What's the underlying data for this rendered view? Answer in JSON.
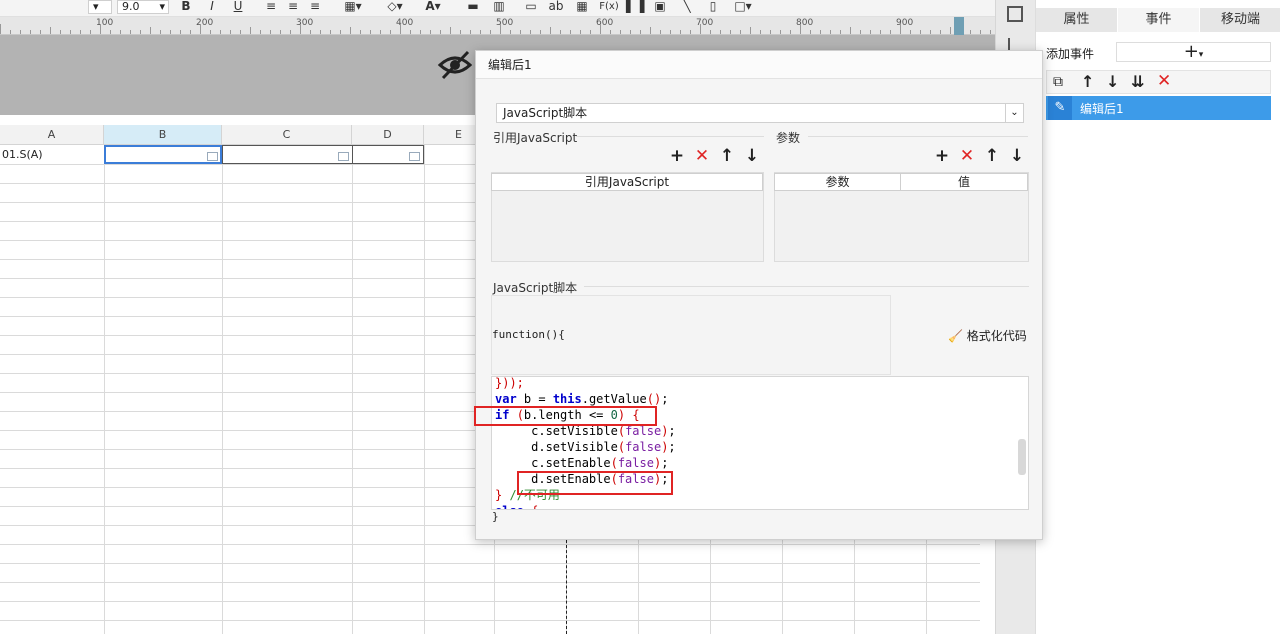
{
  "toolbar": {
    "font_size": "9.0",
    "bold": "B",
    "italic": "I",
    "underline": "U",
    "text_label": "ab",
    "formula_label": "F(x)"
  },
  "ruler": {
    "marks": [
      "100",
      "200",
      "300",
      "400",
      "500",
      "600",
      "700",
      "800",
      "900"
    ]
  },
  "sheet": {
    "columns": [
      "A",
      "B",
      "C",
      "D",
      "E"
    ],
    "cell_a1": "01.S(A)"
  },
  "right_panel": {
    "tabs": [
      "属性",
      "事件",
      "移动端"
    ],
    "add_event_label": "添加事件",
    "add_button": "+",
    "event_item": "编辑后1"
  },
  "dialog": {
    "title": "编辑后1",
    "script_type": "JavaScript脚本",
    "ref_js_label": "引用JavaScript",
    "params_label": "参数",
    "ref_js_header": "引用JavaScript",
    "param_header": "参数",
    "value_header": "值",
    "script_label": "JavaScript脚本",
    "function_header": "function(){",
    "format_button": "格式化代码",
    "code_lines": [
      "}));",
      "var b = this.getValue();",
      "if (b.length <= 0) {",
      "    c.setVisible(false);",
      "    d.setVisible(false);",
      "    c.setEnable(false);",
      "    d.setEnable(false);",
      "} //不可用",
      "else {"
    ],
    "closing_brace": "}"
  }
}
